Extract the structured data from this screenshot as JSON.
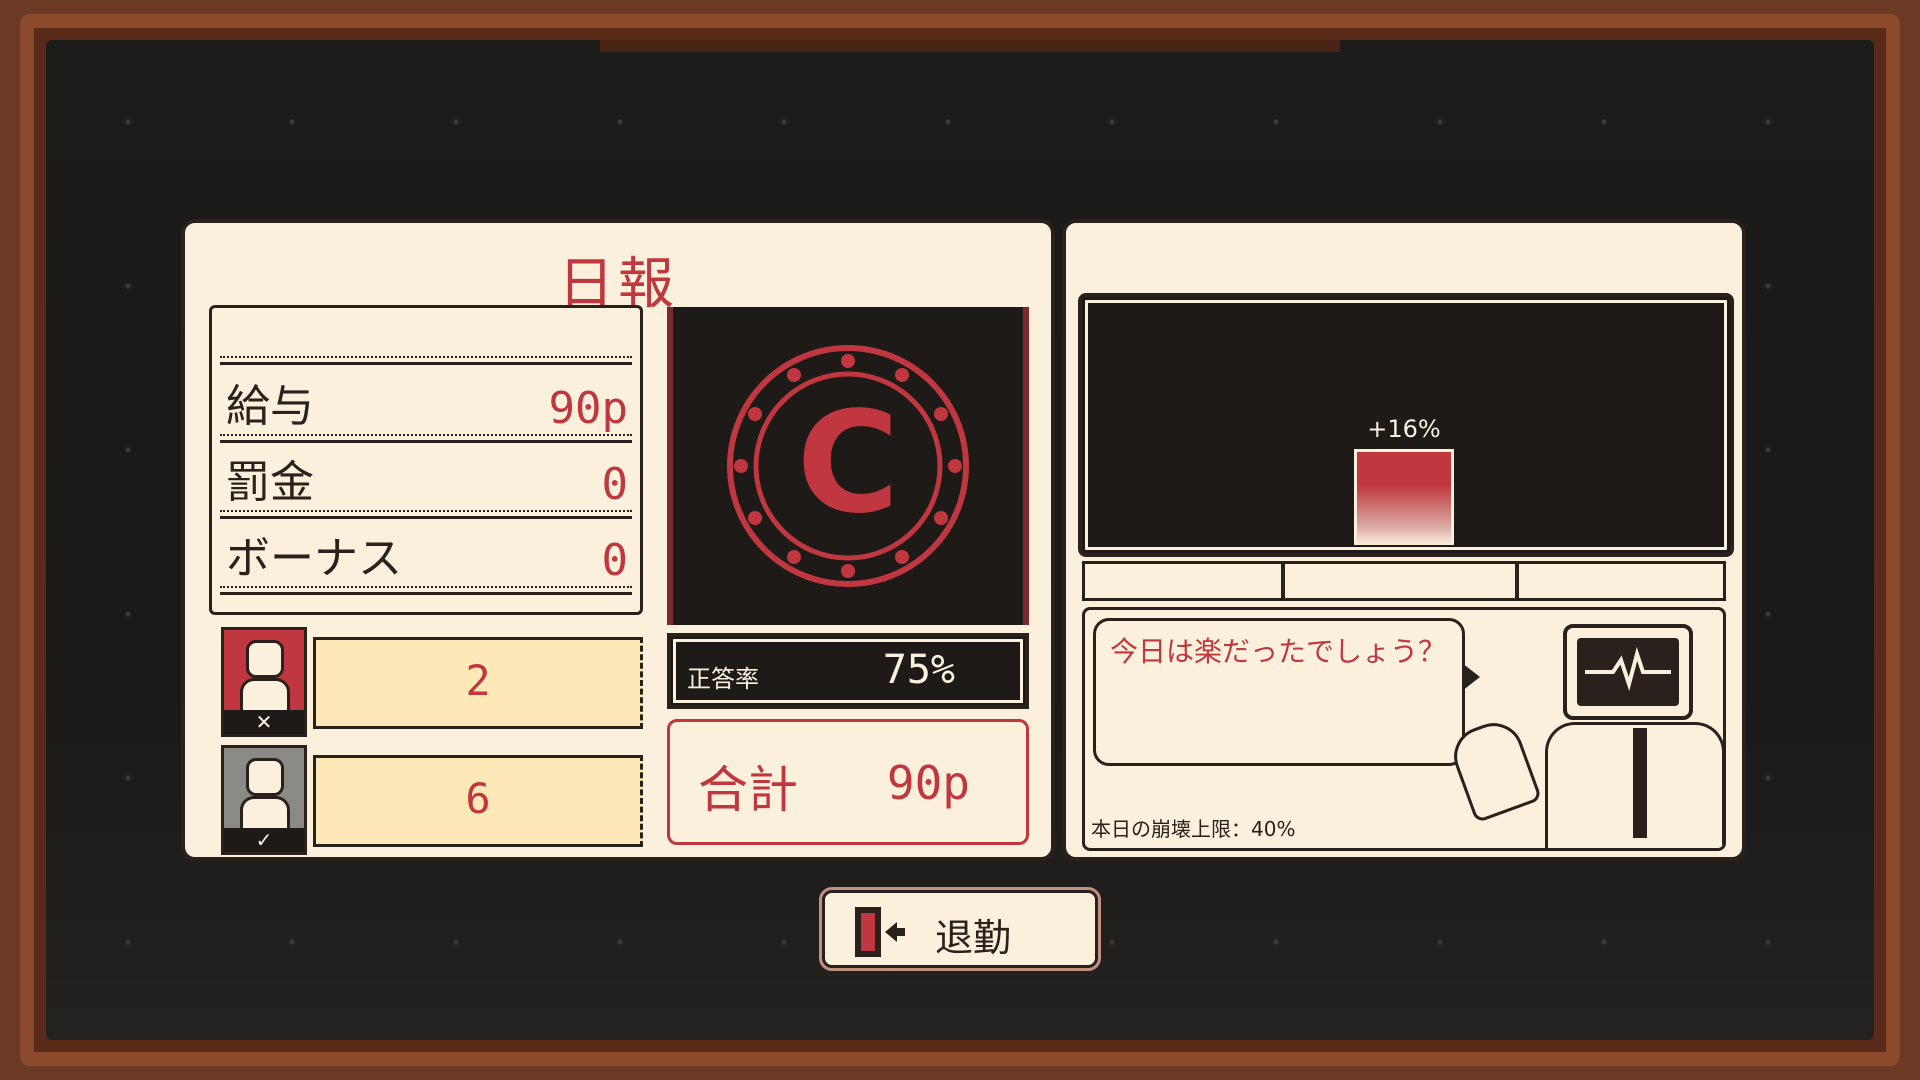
{
  "report": {
    "title": "日報",
    "ledger": [
      {
        "label": "給与",
        "value": "90p"
      },
      {
        "label": "罰金",
        "value": "0"
      },
      {
        "label": "ボーナス",
        "value": "0"
      }
    ],
    "stats": [
      {
        "mark": "✕",
        "value": "2",
        "color": "#c0373f"
      },
      {
        "mark": "✓",
        "value": "6",
        "color": "#8a8a86"
      }
    ],
    "emblem_letter": "C",
    "accuracy": {
      "label": "正答率",
      "value": "75%"
    },
    "total": {
      "label": "合計",
      "value": "90p"
    }
  },
  "panel": {
    "graph": {
      "bar_label": "+16%",
      "value_percent": 16
    },
    "speech": "今日は楽だったでしょう？",
    "limit": "本日の崩壊上限：40%"
  },
  "exit_button": {
    "label": "退勤"
  },
  "colors": {
    "accent": "#c0373f",
    "paper": "#fbf0dc",
    "ink": "#2a201c",
    "frame": "#8c4a2c"
  }
}
